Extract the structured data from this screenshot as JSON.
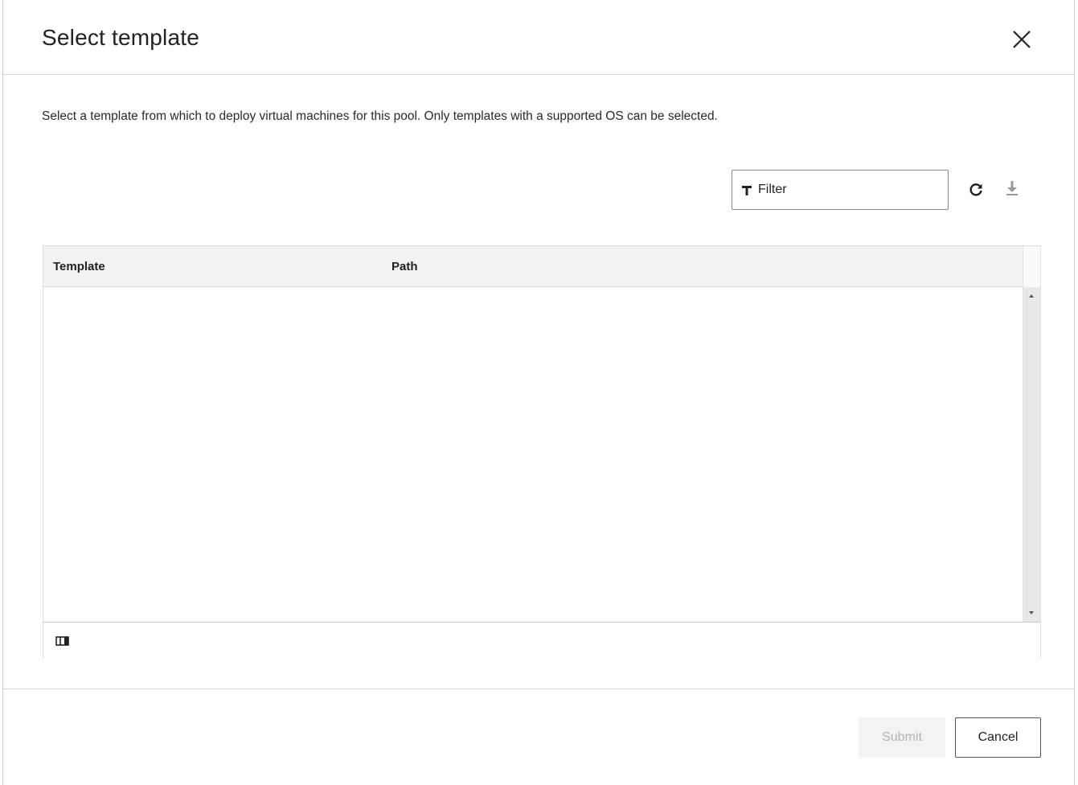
{
  "dialog": {
    "title": "Select template",
    "close_icon": "close-icon",
    "description": "Select a template from which to deploy virtual machines for this pool. Only templates with a supported OS can be selected."
  },
  "toolbar": {
    "filter_placeholder": "Filter",
    "filter_value": "",
    "filter_icon": "filter-icon",
    "refresh_icon": "refresh-icon",
    "export_icon": "download-icon"
  },
  "grid": {
    "columns": [
      "Template",
      "Path"
    ],
    "rows": [],
    "footer_icon": "column-toggle-icon"
  },
  "buttons": {
    "submit_label": "Submit",
    "cancel_label": "Cancel",
    "submit_disabled": true
  }
}
